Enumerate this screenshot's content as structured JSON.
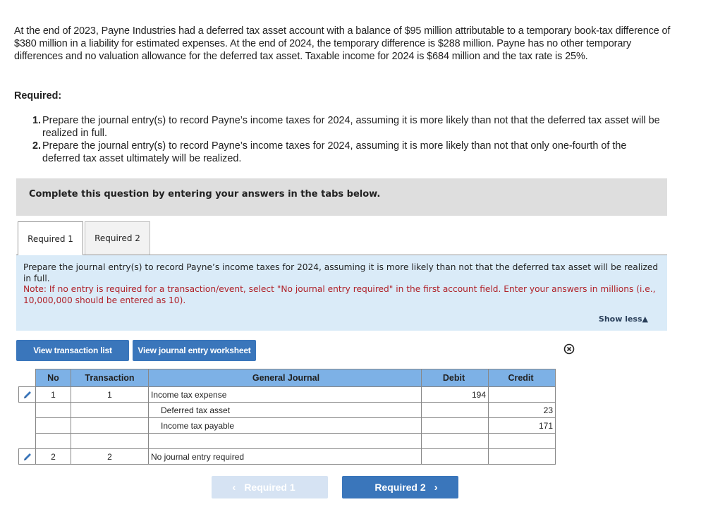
{
  "problem": {
    "text": "At the end of 2023, Payne Industries had a deferred tax asset account with a balance of $95 million attributable to a temporary book-tax difference of $380 million in a liability for estimated expenses. At the end of 2024, the temporary difference is $288 million. Payne has no other temporary differences and no valuation allowance for the deferred tax asset. Taxable income for 2024 is $684 million and the tax rate is 25%."
  },
  "required": {
    "heading": "Required:",
    "items": [
      {
        "num": "1.",
        "text": "Prepare the journal entry(s) to record Payne’s income taxes for 2024, assuming it is more likely than not that the deferred tax asset will be realized in full."
      },
      {
        "num": "2.",
        "text": "Prepare the journal entry(s) to record Payne’s income taxes for 2024, assuming it is more likely than not that only one-fourth of the deferred tax asset ultimately will be realized."
      }
    ]
  },
  "instruction_banner": "Complete this question by entering your answers in the tabs below.",
  "tabs": [
    {
      "label": "Required 1",
      "active": true
    },
    {
      "label": "Required 2",
      "active": false
    }
  ],
  "panel": {
    "prompt": "Prepare the journal entry(s) to record Payne’s income taxes for 2024, assuming it is more likely than not that the deferred tax asset will be realized in full.",
    "note": "Note: If no entry is required for a transaction/event, select \"No journal entry required\" in the first account field. Enter your answers in millions (i.e., 10,000,000 should be entered as 10).",
    "show_less": "Show less",
    "show_less_icon": "triangle-up-icon"
  },
  "buttons": {
    "view_transaction_list": "View transaction list",
    "view_journal_worksheet": "View journal entry worksheet",
    "close_icon": "circle-x-icon"
  },
  "journal": {
    "headers": {
      "no": "No",
      "transaction": "Transaction",
      "account": "General Journal",
      "debit": "Debit",
      "credit": "Credit"
    },
    "entries": [
      {
        "no": "1",
        "transaction": "1",
        "lines": [
          {
            "account": "Income tax expense",
            "debit": "194",
            "credit": ""
          },
          {
            "account": "Deferred tax asset",
            "debit": "",
            "credit": "23"
          },
          {
            "account": "Income tax payable",
            "debit": "",
            "credit": "171"
          },
          {
            "account": "",
            "debit": "",
            "credit": ""
          }
        ]
      },
      {
        "no": "2",
        "transaction": "2",
        "lines": [
          {
            "account": "No journal entry required",
            "debit": "",
            "credit": ""
          }
        ]
      }
    ]
  },
  "nav": {
    "prev_label": "Required 1",
    "next_label": "Required 2",
    "prev_icon": "‹",
    "next_icon": "›"
  }
}
